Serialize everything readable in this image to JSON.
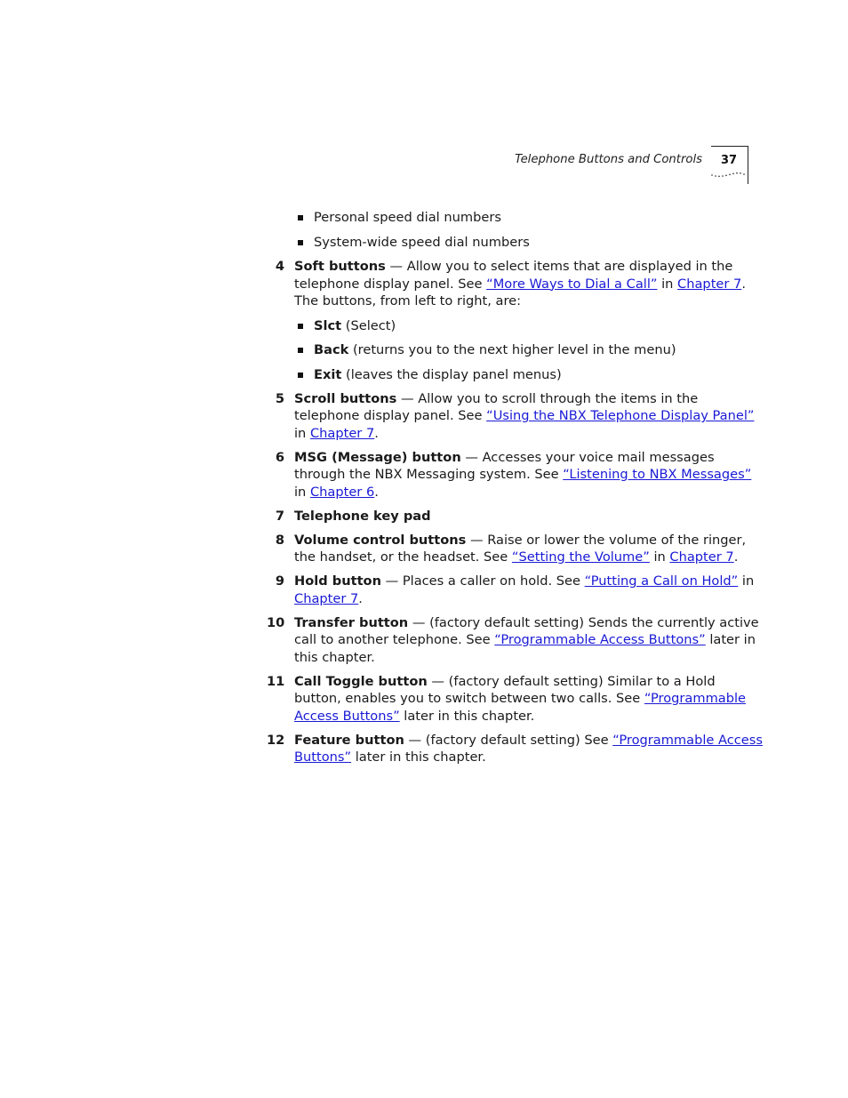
{
  "header": {
    "running_title": "Telephone Buttons and Controls",
    "page_number": "37"
  },
  "top_bullets": [
    "Personal speed dial numbers",
    "System-wide speed dial numbers"
  ],
  "items": {
    "i4": {
      "num": "4",
      "title": "Soft buttons",
      "t1": " — Allow you to select items that are displayed in the telephone display panel. See ",
      "link1": "“More Ways to Dial a Call”",
      "t2": " in ",
      "link2": "Chapter 7",
      "t3": ". The buttons, from left to right, are:",
      "sub": [
        {
          "bold": "Slct",
          "text": " (Select)"
        },
        {
          "bold": "Back",
          "text": " (returns you to the next higher level in the menu)"
        },
        {
          "bold": "Exit",
          "text": " (leaves the display panel menus)"
        }
      ]
    },
    "i5": {
      "num": "5",
      "title": "Scroll buttons",
      "t1": " — Allow you to scroll through the items in the telephone display panel. See ",
      "link1": "“Using the NBX Telephone Display Panel”",
      "t2": " in ",
      "link2": "Chapter 7",
      "t3": "."
    },
    "i6": {
      "num": "6",
      "title": "MSG (Message) button",
      "t1": " — Accesses your voice mail messages through the NBX Messaging system. See ",
      "link1": "“Listening to NBX Messages”",
      "t2": " in ",
      "link2": "Chapter 6",
      "t3": "."
    },
    "i7": {
      "num": "7",
      "title": "Telephone key pad"
    },
    "i8": {
      "num": "8",
      "title": "Volume control buttons",
      "t1": " — Raise or lower the volume of the ringer, the handset, or the headset. See ",
      "link1": "“Setting the Volume”",
      "t2": " in ",
      "link2": "Chapter 7",
      "t3": "."
    },
    "i9": {
      "num": "9",
      "title": "Hold button",
      "t1": " — Places a caller on hold. See ",
      "link1": "“Putting a Call on Hold”",
      "t2": " in ",
      "link2": "Chapter 7",
      "t3": "."
    },
    "i10": {
      "num": "10",
      "title": "Transfer button",
      "t1": " — (factory default setting) Sends the currently active call to another telephone. See ",
      "link1": "“Programmable Access Buttons”",
      "t2": " later in this chapter."
    },
    "i11": {
      "num": "11",
      "title": "Call Toggle button",
      "t1": " — (factory default setting) Similar to a Hold button, enables you to switch between two calls. See ",
      "link1": "“Programmable Access Buttons”",
      "t2": " later in this chapter."
    },
    "i12": {
      "num": "12",
      "title": "Feature button",
      "t1": " — (factory default setting) See ",
      "link1": "“Programmable Access Buttons”",
      "t2": " later in this chapter."
    }
  },
  "colors": {
    "link": "#1a1ad6",
    "text": "#1a1a1a"
  }
}
